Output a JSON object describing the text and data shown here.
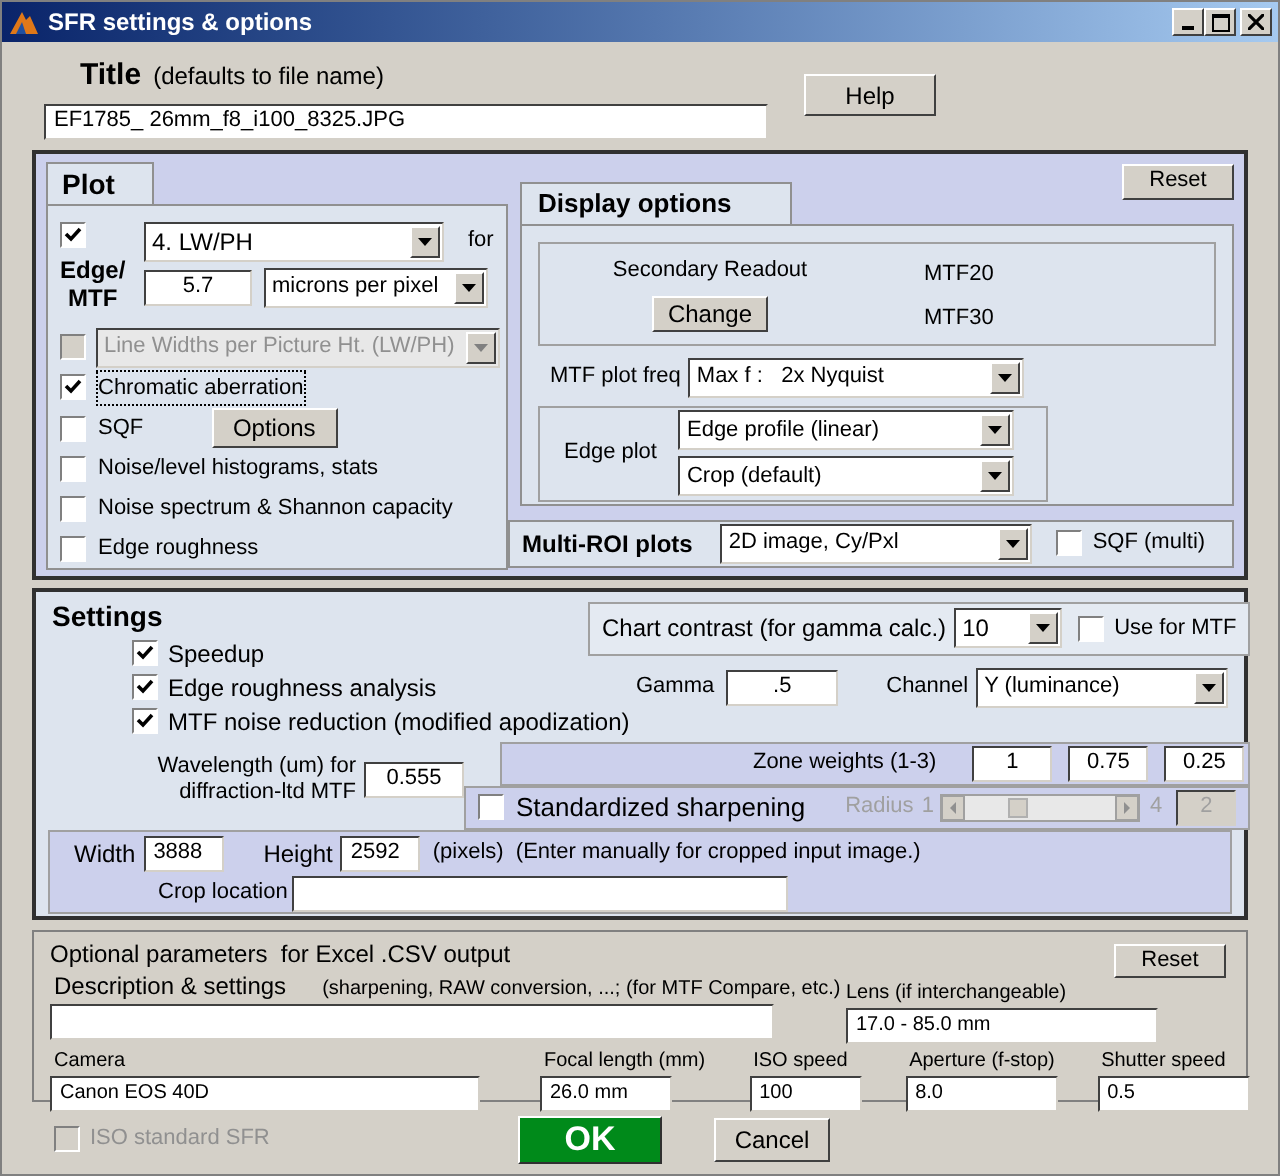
{
  "window": {
    "title": "SFR settings & options"
  },
  "title": {
    "label": "Title",
    "hint": "(defaults to file name)",
    "value": "EF1785_ 26mm_f8_i100_8325.JPG"
  },
  "help_button": "Help",
  "plot": {
    "heading": "Plot",
    "edge_mtf": {
      "checked": true,
      "label": [
        "Edge/",
        "MTF"
      ],
      "frequency": "4. LW/PH",
      "for_label": "for",
      "pixel_size": "5.7",
      "pixel_unit": "microns per pixel"
    },
    "lw_ph": {
      "checked": false,
      "disabled": true,
      "value": "Line Widths per Picture Ht. (LW/PH)"
    },
    "options": [
      {
        "label": "Chromatic aberration",
        "checked": true,
        "focused": true
      },
      {
        "label": "SQF",
        "checked": false,
        "focused": false,
        "button": "Options"
      },
      {
        "label": "Noise/level histograms, stats",
        "checked": false,
        "focused": false
      },
      {
        "label": "Noise spectrum & Shannon capacity",
        "checked": false,
        "focused": false
      },
      {
        "label": "Edge roughness",
        "checked": false,
        "focused": false
      }
    ]
  },
  "display_options": {
    "heading": "Display options",
    "reset_button": "Reset",
    "secondary_readout_label": "Secondary Readout",
    "change_button": "Change",
    "readouts": [
      "MTF20",
      "MTF30"
    ],
    "mtf_plot_freq_label": "MTF plot freq",
    "mtf_plot_freq": "Max f :   2x Nyquist",
    "edge_plot_label": "Edge plot",
    "edge_plot": [
      "Edge profile (linear)",
      "Crop (default)"
    ]
  },
  "multi_roi": {
    "label": "Multi-ROI plots",
    "value": "2D image, Cy/Pxl",
    "sqf_multi": {
      "label": "SQF (multi)",
      "checked": false
    }
  },
  "settings": {
    "heading": "Settings",
    "checkboxes": [
      {
        "label": "Speedup",
        "checked": true
      },
      {
        "label": "Edge roughness analysis",
        "checked": true
      },
      {
        "label": "MTF noise reduction (modified apodization)",
        "checked": true
      }
    ],
    "chart_contrast": {
      "label": "Chart contrast (for gamma calc.)",
      "value": "10",
      "use_for_mtf": {
        "label": "Use for MTF",
        "checked": false
      }
    },
    "gamma": {
      "label": "Gamma",
      "value": ".5"
    },
    "channel": {
      "label": "Channel",
      "value": "Y (luminance)"
    },
    "wavelength": {
      "label": [
        "Wavelength (um) for",
        "diffraction-ltd MTF"
      ],
      "value": "0.555"
    },
    "zone_weights": {
      "label": "Zone weights (1-3)",
      "values": [
        "1",
        "0.75",
        "0.25"
      ]
    },
    "sharpening": {
      "label": "Standardized sharpening",
      "checked": false,
      "radius_label": "Radius",
      "min": "1",
      "max": "4",
      "level": 0.33,
      "value": "2",
      "radius_disabled": true
    },
    "width": {
      "label": "Width",
      "value": "3888"
    },
    "height": {
      "label": "Height",
      "value": "2592"
    },
    "size_note": "(pixels)  (Enter manually for cropped input image.)",
    "crop_location_label": "Crop location"
  },
  "optional": {
    "heading": "Optional parameters  for Excel .CSV output",
    "reset_button": "Reset",
    "description_label": "Description & settings",
    "description_hint": "(sharpening, RAW conversion, ...; (for MTF Compare, etc.)",
    "lens": {
      "label": "Lens (if interchangeable)",
      "value": "17.0 - 85.0 mm"
    },
    "fields": [
      {
        "label": "Camera",
        "value": "Canon EOS 40D"
      },
      {
        "label": "Focal length (mm)",
        "value": "26.0 mm"
      },
      {
        "label": "ISO speed",
        "value": "100"
      },
      {
        "label": "Aperture (f-stop)",
        "value": "8.0"
      },
      {
        "label": "Shutter speed",
        "value": "0.5"
      }
    ]
  },
  "iso_standard": {
    "label": "ISO standard SFR",
    "checked": false,
    "disabled": true
  },
  "ok_button": "OK",
  "cancel_button": "Cancel"
}
